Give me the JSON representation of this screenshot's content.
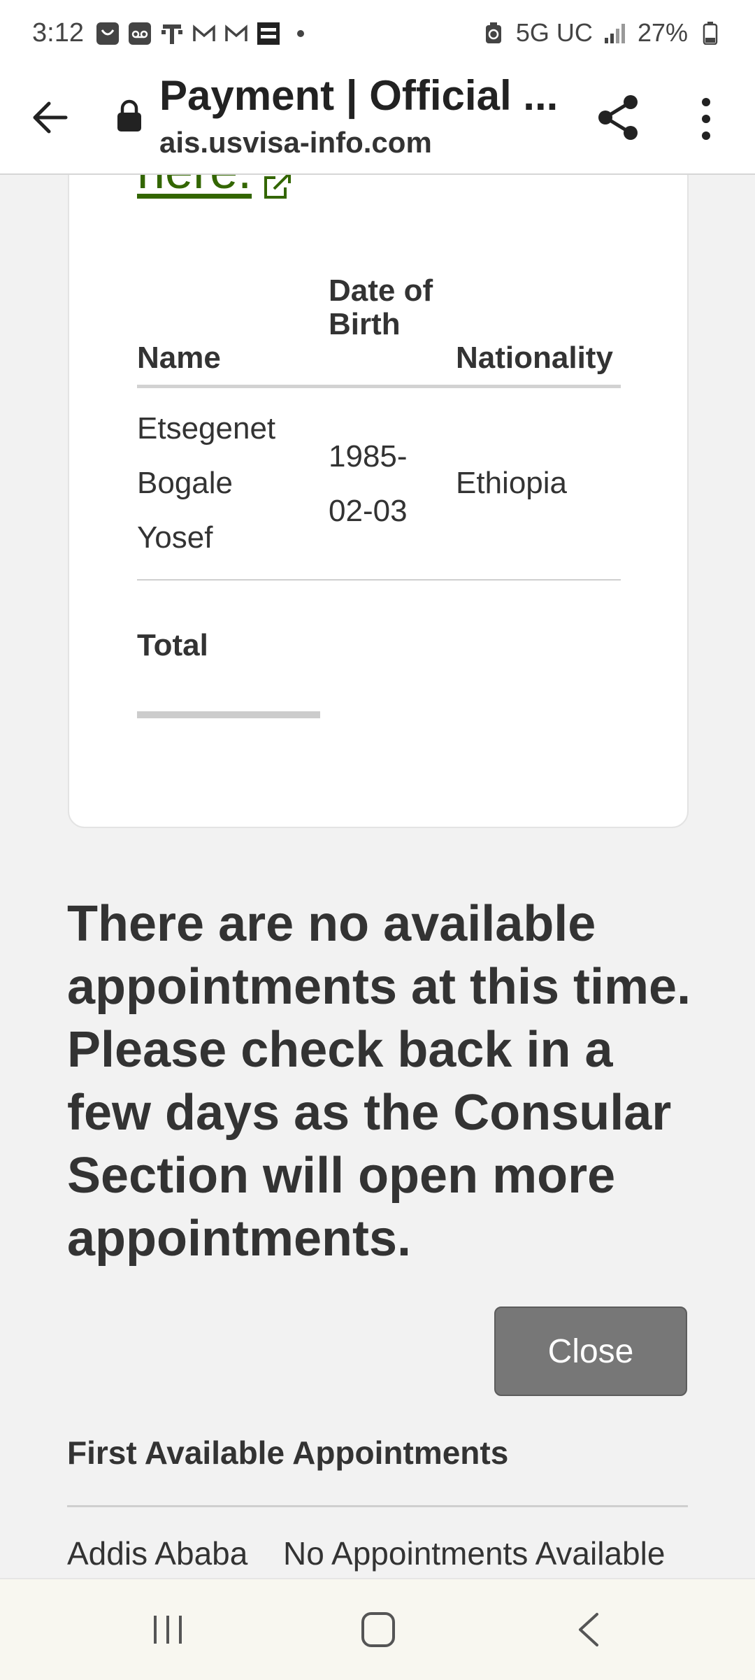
{
  "status_bar": {
    "time": "3:12",
    "network": "5G UC",
    "battery": "27%"
  },
  "toolbar": {
    "title": "Payment | Official ...",
    "url": "ais.usvisa-info.com"
  },
  "card": {
    "link_text": "here.",
    "table": {
      "headers": {
        "name": "Name",
        "dob": "Date of Birth",
        "nationality": "Nationality"
      },
      "row": {
        "name": "Etsegenet Bogale Yosef",
        "dob": "1985-02-03",
        "nationality": "Ethiopia"
      }
    },
    "total_label": "Total"
  },
  "notice": "There are no available appointments at this time. Please check back in a few days as the Consular Section will open more appointments.",
  "close_label": "Close",
  "first_available": {
    "heading": "First Available Appointments",
    "rows": [
      {
        "city": "Addis Ababa",
        "status": "No Appointments Available"
      }
    ]
  },
  "colors": {
    "link": "#336600",
    "button": "#777777",
    "page_bg": "#f2f2f2",
    "text": "#333333"
  }
}
